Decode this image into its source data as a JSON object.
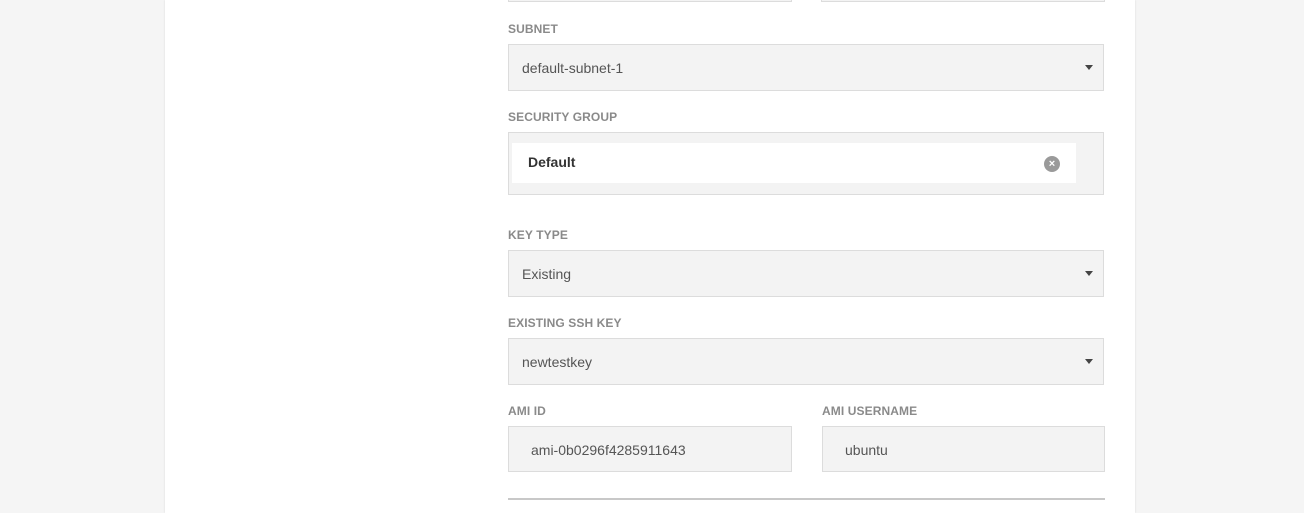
{
  "form": {
    "subnet": {
      "label": "SUBNET",
      "value": "default-subnet-1"
    },
    "security_group": {
      "label": "SECURITY GROUP",
      "chips": [
        "Default"
      ],
      "remove_glyph": "×"
    },
    "key_type": {
      "label": "KEY TYPE",
      "value": "Existing"
    },
    "existing_ssh_key": {
      "label": "EXISTING SSH KEY",
      "value": "newtestkey"
    },
    "ami_id": {
      "label": "AMI ID",
      "value": "ami-0b0296f4285911643"
    },
    "ami_username": {
      "label": "AMI USERNAME",
      "value": "ubuntu"
    }
  },
  "icons": {
    "dropdown": "caret-down-icon",
    "remove": "close-circle-icon"
  },
  "colors": {
    "background": "#f5f5f5",
    "card": "#ffffff",
    "field": "#f3f3f3",
    "label": "#8a8a8a"
  }
}
